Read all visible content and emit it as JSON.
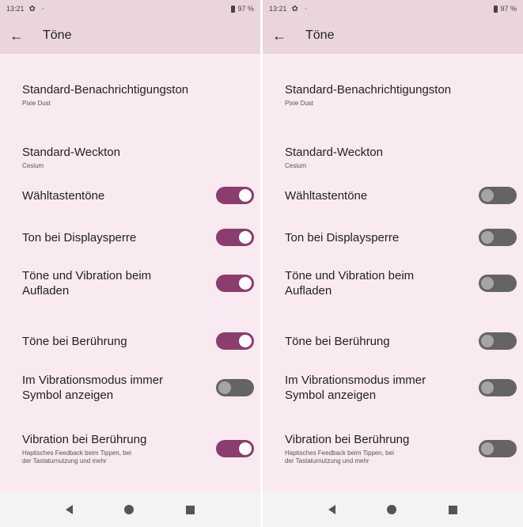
{
  "screens": [
    {
      "status": {
        "time": "13:21",
        "battery": "97 %"
      },
      "appbar": {
        "title": "Töne"
      },
      "items": [
        {
          "label": "Standard-Benachrichtigungston",
          "sub": "Pixie Dust"
        },
        {
          "label": "Standard-Weckton",
          "sub": "Cesium"
        },
        {
          "label": "Wähltastentöne",
          "toggle": true
        },
        {
          "label": "Ton bei Displaysperre",
          "toggle": true
        },
        {
          "label": "Töne und Vibration beim\nAufladen",
          "toggle": true
        },
        {
          "label": "Töne bei Berührung",
          "toggle": true
        },
        {
          "label": "Im Vibrationsmodus immer\nSymbol anzeigen",
          "toggle": false
        },
        {
          "label": "Vibration bei Berührung",
          "sub": "Haptisches Feedback beim Tippen, bei\nder Tastaturnutzung und mehr",
          "toggle": true
        }
      ]
    },
    {
      "status": {
        "time": "13:21",
        "battery": "97 %"
      },
      "appbar": {
        "title": "Töne"
      },
      "items": [
        {
          "label": "Standard-Benachrichtigungston",
          "sub": "Pixie Dust"
        },
        {
          "label": "Standard-Weckton",
          "sub": "Cesium"
        },
        {
          "label": "Wähltastentöne",
          "toggle": false
        },
        {
          "label": "Ton bei Displaysperre",
          "toggle": false
        },
        {
          "label": "Töne und Vibration beim\nAufladen",
          "toggle": false
        },
        {
          "label": "Töne bei Berührung",
          "toggle": false
        },
        {
          "label": "Im Vibrationsmodus immer\nSymbol anzeigen",
          "toggle": false
        },
        {
          "label": "Vibration bei Berührung",
          "sub": "Haptisches Feedback beim Tippen, bei\nder Tastaturnutzung und mehr",
          "toggle": false
        }
      ]
    }
  ],
  "colors": {
    "toggle_on": "#8b3d6e",
    "toggle_off": "#646464",
    "background": "#f8eaf0",
    "appbar": "#ead5dd"
  }
}
